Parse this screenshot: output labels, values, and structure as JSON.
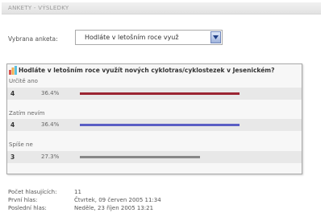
{
  "header": {
    "title": "ANKETY - VÝSLEDKY"
  },
  "selector": {
    "label": "Vybrana anketa:",
    "selected_value": "Hodláte v letošním roce využ"
  },
  "poll": {
    "question": "Hodláte v letošním roce využít nových cyklotras/cyklostezek v Jesenickém?",
    "answers": [
      {
        "label": "Určitě ano",
        "count": "4",
        "percent": "36.4%",
        "fraction": 0.364,
        "color": "#9b2432"
      },
      {
        "label": "Zatím nevím",
        "count": "4",
        "percent": "36.4%",
        "fraction": 0.364,
        "color": "#5a5ec4"
      },
      {
        "label": "Spíše ne",
        "count": "3",
        "percent": "27.3%",
        "fraction": 0.273,
        "color": "#888888"
      }
    ]
  },
  "stats": [
    {
      "label": "Počet hlasujících:",
      "value": "11"
    },
    {
      "label": "První hlas:",
      "value": "Čtvrtek, 09 červen 2005 11:34"
    },
    {
      "label": "Poslední hlas:",
      "value": "Neděle, 23 říjen 2005 13:21"
    }
  ]
}
